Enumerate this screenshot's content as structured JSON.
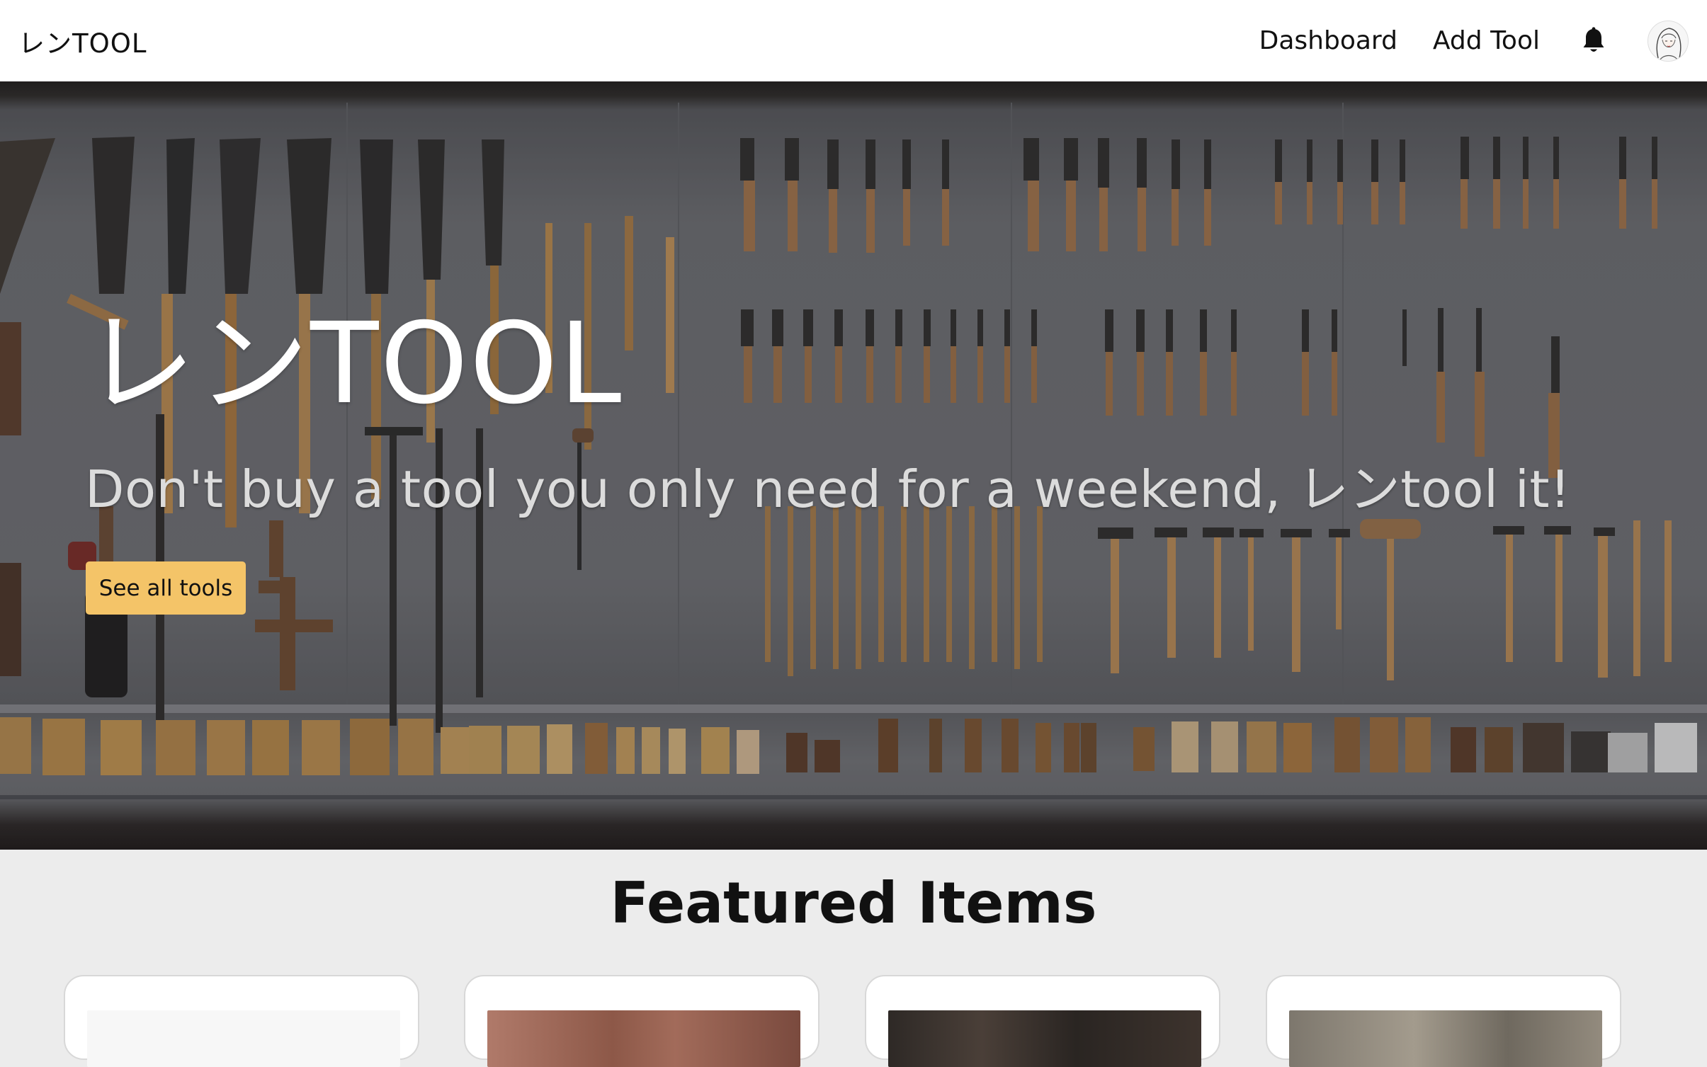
{
  "navbar": {
    "logo": "レンTOOL",
    "links": [
      "Dashboard",
      "Add Tool"
    ],
    "icons": [
      "bell-icon",
      "avatar"
    ]
  },
  "hero": {
    "title": "レンTOOL",
    "tagline": "Don't buy a tool you only need for a weekend, レンtool it!",
    "cta_label": "See all tools",
    "cta_color": "#f4c468"
  },
  "featured": {
    "title": "Featured Items",
    "cards": [
      {
        "image_tone": "#f7f7f7"
      },
      {
        "image_tone": "#9a5f50"
      },
      {
        "image_tone": "#3a3430"
      },
      {
        "image_tone": "#8c857a"
      }
    ]
  }
}
